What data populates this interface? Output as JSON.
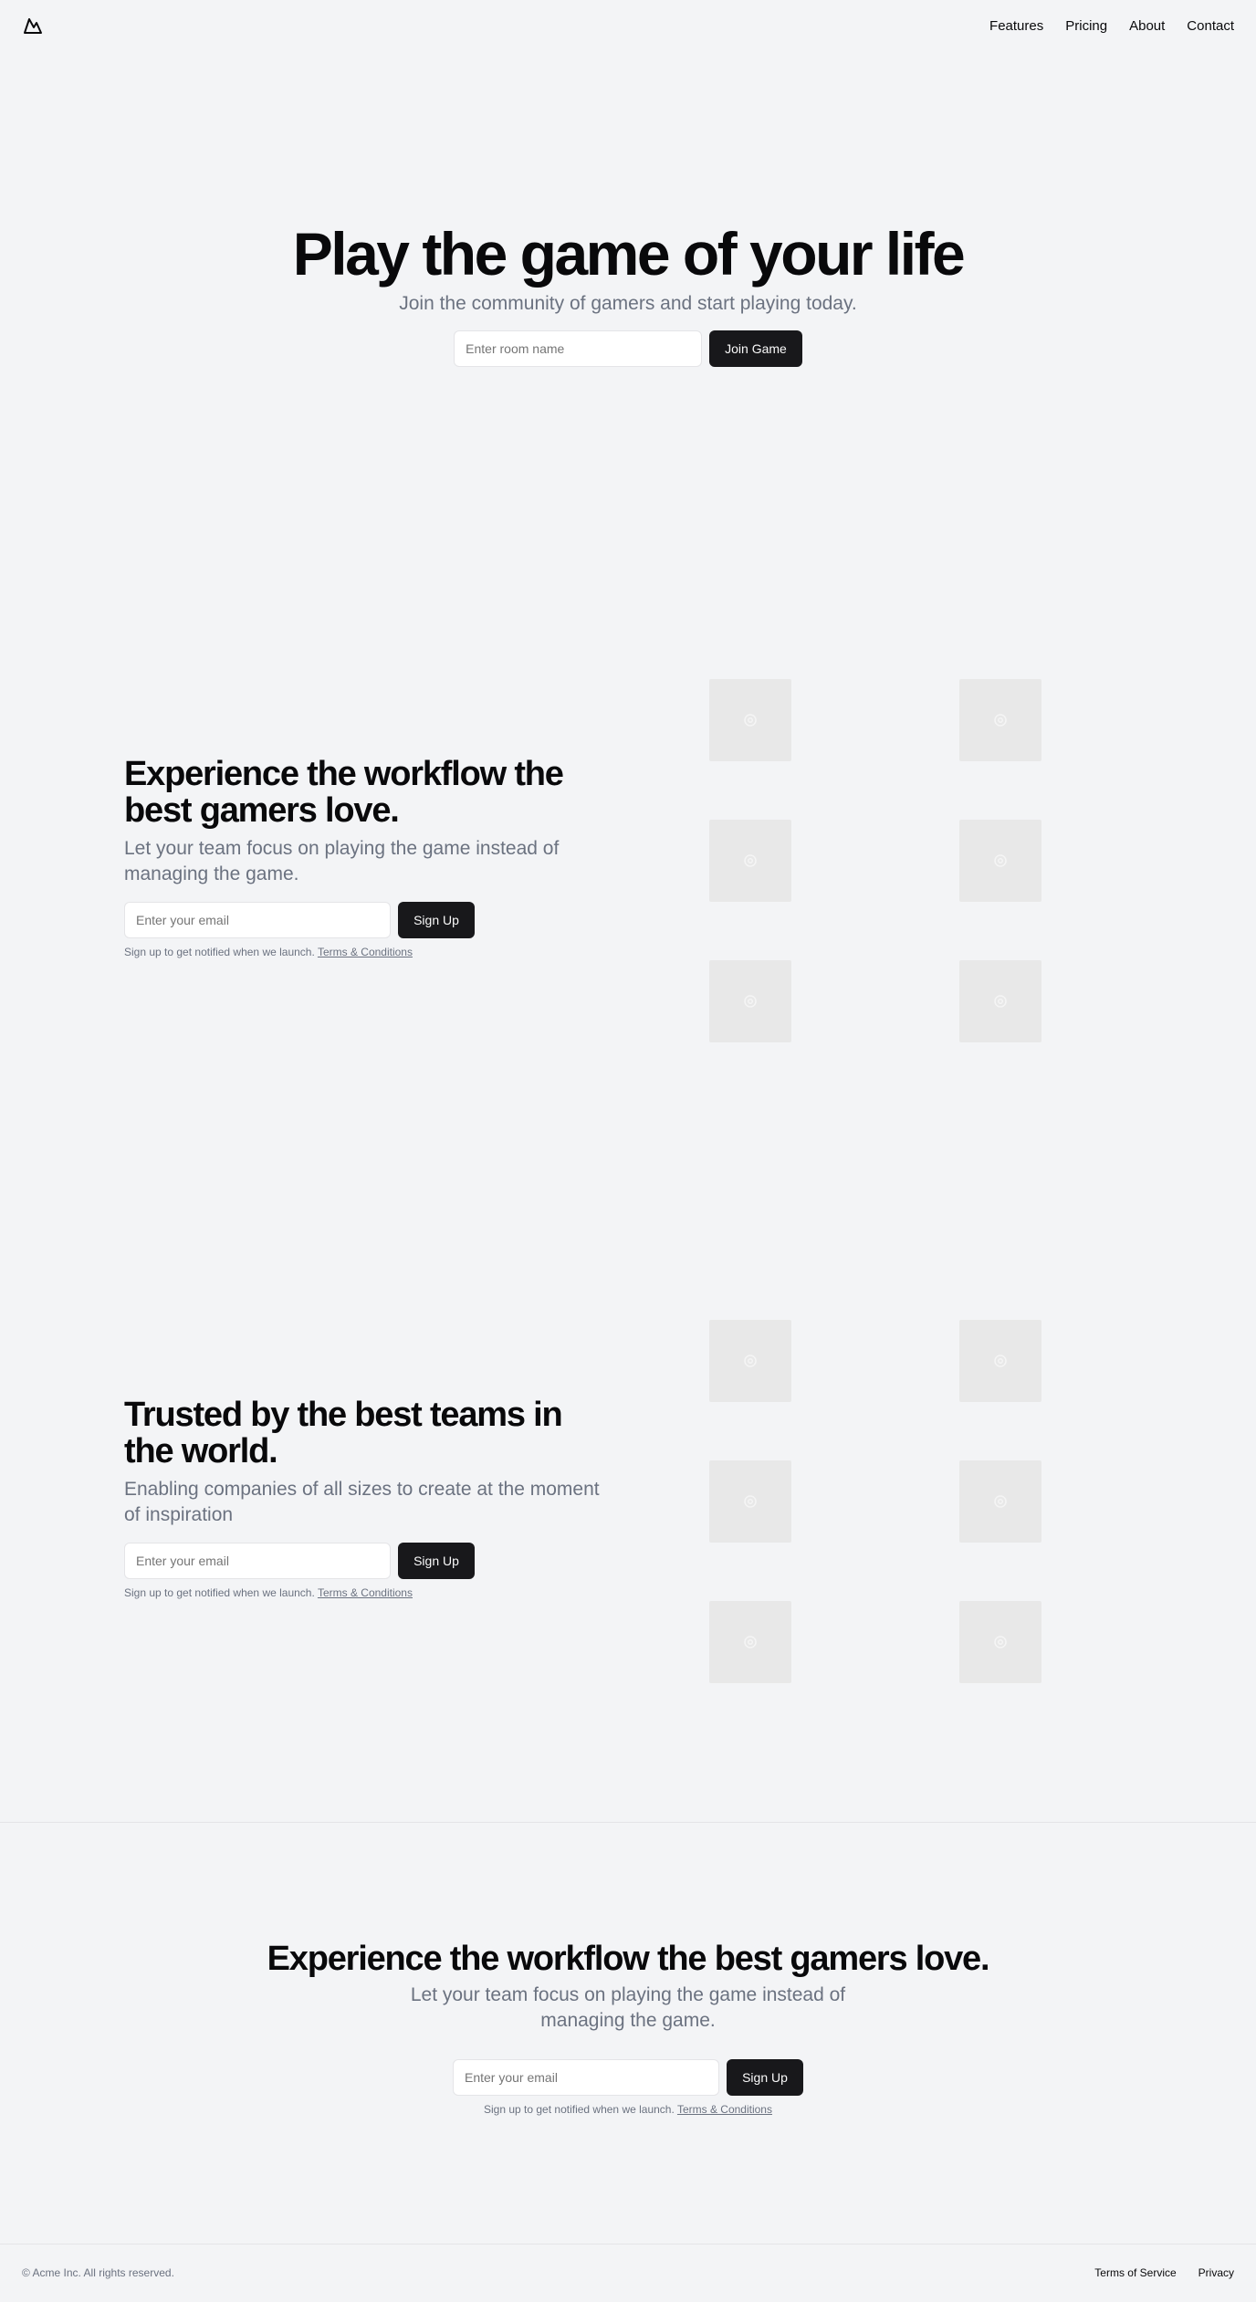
{
  "nav": {
    "logo_icon": "mountain-icon",
    "links": [
      "Features",
      "Pricing",
      "About",
      "Contact"
    ]
  },
  "hero": {
    "title": "Play the game of your life",
    "subtitle": "Join the community of gamers and start playing today.",
    "input_placeholder": "Enter room name",
    "button": "Join Game"
  },
  "feature1": {
    "title": "Experience the workflow the best gamers love.",
    "subtitle": "Let your team focus on playing the game instead of managing the game.",
    "input_placeholder": "Enter your email",
    "button": "Sign Up",
    "note": "Sign up to get notified when we launch.",
    "terms": "Terms & Conditions"
  },
  "feature2": {
    "title": "Trusted by the best teams in the world.",
    "subtitle": "Enabling companies of all sizes to create at the moment of inspiration",
    "input_placeholder": "Enter your email",
    "button": "Sign Up",
    "note": "Sign up to get notified when we launch.",
    "terms": "Terms & Conditions"
  },
  "cta": {
    "title": "Experience the workflow the best gamers love.",
    "subtitle": "Let your team focus on playing the game instead of managing the game.",
    "input_placeholder": "Enter your email",
    "button": "Sign Up",
    "note": "Sign up to get notified when we launch.",
    "terms": "Terms & Conditions"
  },
  "footer": {
    "copyright": "© Acme Inc. All rights reserved.",
    "links": [
      "Terms of Service",
      "Privacy"
    ]
  }
}
